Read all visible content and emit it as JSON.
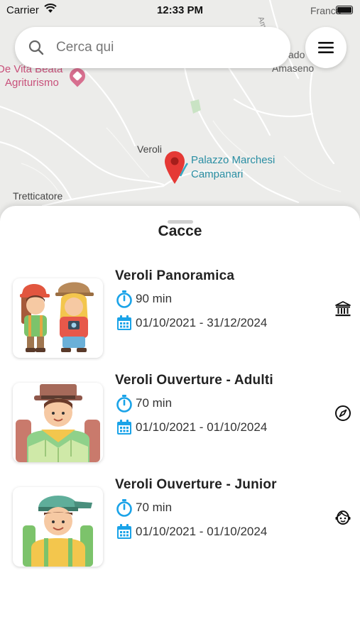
{
  "status_bar": {
    "carrier": "Carrier",
    "time": "12:33 PM"
  },
  "map": {
    "labels": {
      "agriturismo_line1": "De Vita Beata",
      "agriturismo_line2": "Agriturismo",
      "veroli": "Veroli",
      "palazzo_line1": "Palazzo Marchesi",
      "palazzo_line2": "Campanari",
      "tretticatore": "Tretticatore",
      "amaseno_line1": "ado",
      "amaseno_line2": "Amaseno",
      "top_right": "Franca",
      "road_vertical": "Amaseno"
    },
    "colors": {
      "pin": "#e53935",
      "pink_poi": "#d76f8f",
      "teal_label": "#2a8ea3"
    }
  },
  "search": {
    "placeholder": "Cerca qui",
    "value": "",
    "icon": "search-icon"
  },
  "menu": {
    "icon": "hamburger-menu-icon"
  },
  "sheet": {
    "title": "Cacce",
    "items": [
      {
        "title": "Veroli Panoramica",
        "duration": "90 min",
        "dates": "01/10/2021 - 31/12/2024",
        "side_icon": "bank-icon",
        "thumb": "two-hikers-illustration"
      },
      {
        "title": "Veroli Ouverture - Adulti",
        "duration": "70 min",
        "dates": "01/10/2021 - 01/10/2024",
        "side_icon": "compass-icon",
        "thumb": "adult-explorer-illustration"
      },
      {
        "title": "Veroli Ouverture - Junior",
        "duration": "70 min",
        "dates": "01/10/2021 - 01/10/2024",
        "side_icon": "smiley-icon",
        "thumb": "junior-explorer-illustration"
      }
    ],
    "accent_color": "#1aa3e8"
  }
}
